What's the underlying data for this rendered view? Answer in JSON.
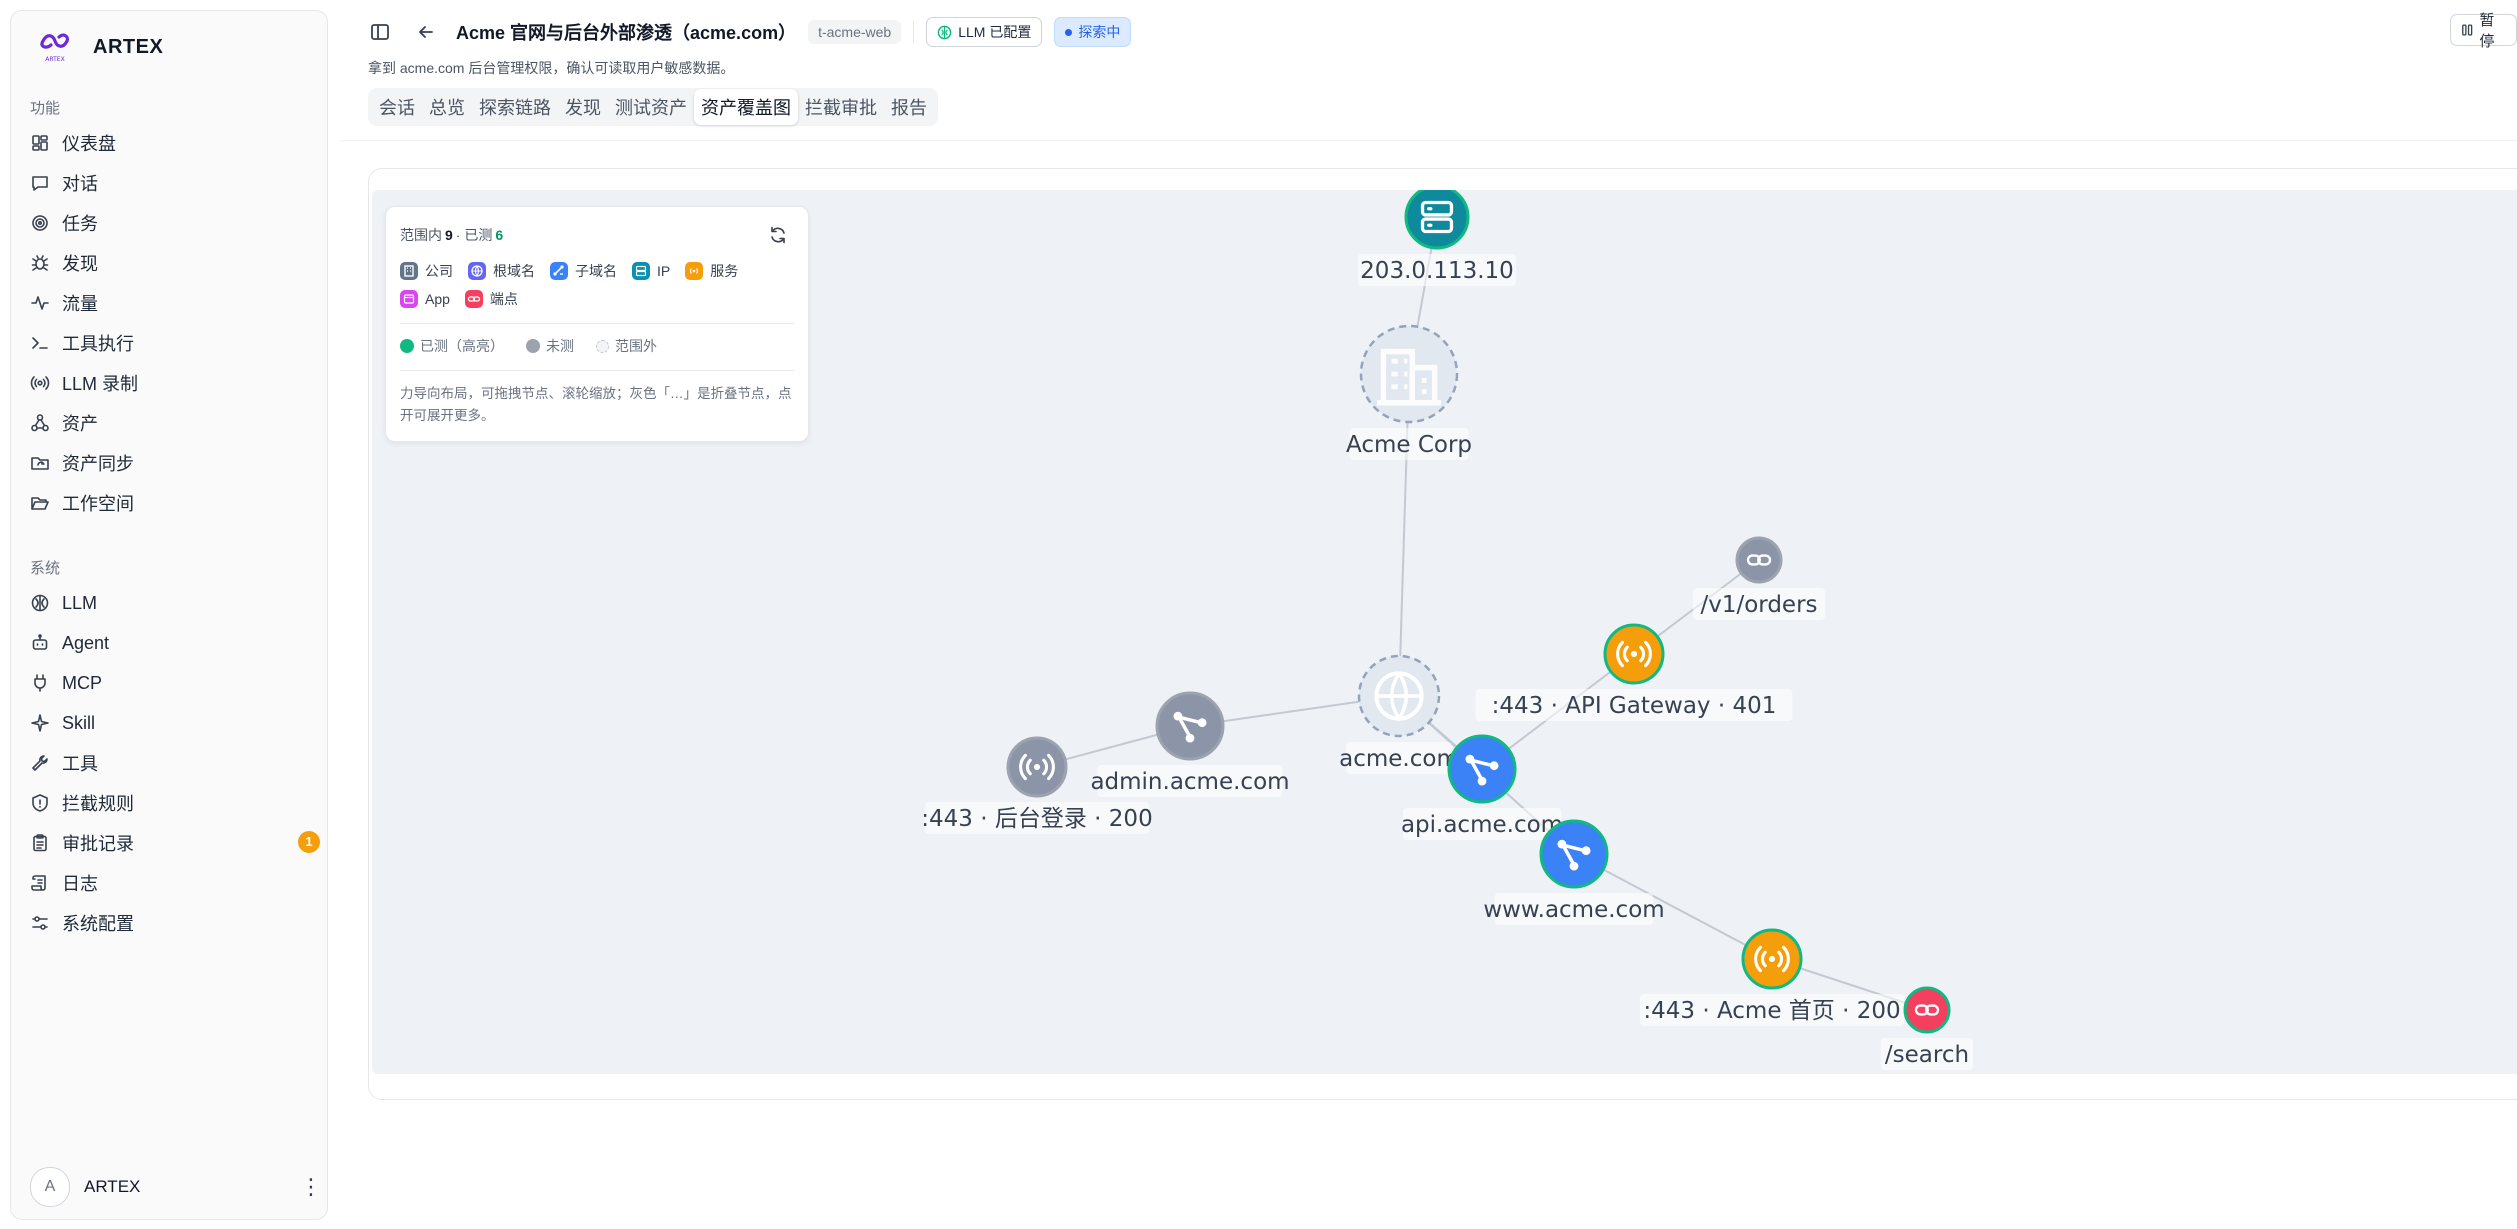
{
  "brand": {
    "name": "ARTEX",
    "logo_text": "ARTEX"
  },
  "sidebar": {
    "section_function": "功能",
    "section_system": "系统",
    "function_items": [
      {
        "label": "仪表盘",
        "icon": "dashboard-icon"
      },
      {
        "label": "对话",
        "icon": "chat-icon"
      },
      {
        "label": "任务",
        "icon": "target-icon"
      },
      {
        "label": "发现",
        "icon": "bug-icon"
      },
      {
        "label": "流量",
        "icon": "activity-icon"
      },
      {
        "label": "工具执行",
        "icon": "terminal-icon"
      },
      {
        "label": "LLM 录制",
        "icon": "radio-icon"
      },
      {
        "label": "资产",
        "icon": "network-icon"
      },
      {
        "label": "资产同步",
        "icon": "folder-sync-icon"
      },
      {
        "label": "工作空间",
        "icon": "folder-open-icon"
      }
    ],
    "system_items": [
      {
        "label": "LLM",
        "icon": "brain-icon"
      },
      {
        "label": "Agent",
        "icon": "bot-icon"
      },
      {
        "label": "MCP",
        "icon": "plug-icon"
      },
      {
        "label": "Skill",
        "icon": "sparkle-icon"
      },
      {
        "label": "工具",
        "icon": "wrench-icon"
      },
      {
        "label": "拦截规则",
        "icon": "shield-icon"
      },
      {
        "label": "审批记录",
        "icon": "clipboard-icon",
        "badge": "1"
      },
      {
        "label": "日志",
        "icon": "scroll-icon"
      },
      {
        "label": "系统配置",
        "icon": "sliders-icon"
      }
    ],
    "user": {
      "initial": "A",
      "name": "ARTEX"
    }
  },
  "header": {
    "title": "Acme 官网与后台外部渗透（acme.com）",
    "project_id": "t-acme-web",
    "llm_chip": "LLM 已配置",
    "status_chip": "探索中",
    "pause_label": "暂停",
    "subtitle": "拿到 acme.com 后台管理权限，确认可读取用户敏感数据。"
  },
  "tabs": [
    {
      "label": "会话",
      "active": false
    },
    {
      "label": "总览",
      "active": false
    },
    {
      "label": "探索链路",
      "active": false
    },
    {
      "label": "发现",
      "active": false
    },
    {
      "label": "测试资产",
      "active": false
    },
    {
      "label": "资产覆盖图",
      "active": true
    },
    {
      "label": "拦截审批",
      "active": false
    },
    {
      "label": "报告",
      "active": false
    }
  ],
  "legend": {
    "in_scope_label": "范围内",
    "in_scope_count": "9",
    "tested_label": "· 已测",
    "tested_count": "6",
    "types": [
      {
        "label": "公司",
        "color": "#64748b",
        "icon": "building-icon"
      },
      {
        "label": "根域名",
        "color": "#6366f1",
        "icon": "globe-icon"
      },
      {
        "label": "子域名",
        "color": "#3b82f6",
        "icon": "share-icon"
      },
      {
        "label": "IP",
        "color": "#0891b2",
        "icon": "server-icon"
      },
      {
        "label": "服务",
        "color": "#f59e0b",
        "icon": "radio-icon"
      },
      {
        "label": "App",
        "color": "#d946ef",
        "icon": "app-icon"
      },
      {
        "label": "端点",
        "color": "#f43f5e",
        "icon": "link-icon"
      }
    ],
    "status": [
      {
        "label": "已测（高亮）",
        "color": "#10b981"
      },
      {
        "label": "未测",
        "color": "#9ca3af"
      },
      {
        "label": "范围外",
        "color": "#e5e7eb"
      }
    ],
    "hint": "力导向布局，可拖拽节点、滚轮缩放；灰色「…」是折叠节点，点开可展开更多。"
  },
  "graph": {
    "nodes": [
      {
        "id": "ip",
        "label": "203.0.113.10",
        "kind": "ip",
        "tested": true
      },
      {
        "id": "company",
        "label": "Acme Corp",
        "kind": "company",
        "tested": false
      },
      {
        "id": "root",
        "label": "acme.com",
        "kind": "root",
        "tested": false
      },
      {
        "id": "admin",
        "label": "admin.acme.com",
        "kind": "subdomain",
        "tested": false
      },
      {
        "id": "admin443",
        "label": ":443 · 后台登录 · 200",
        "kind": "service",
        "tested": false
      },
      {
        "id": "api",
        "label": "api.acme.com",
        "kind": "subdomain",
        "tested": true
      },
      {
        "id": "api443",
        "label": ":443 · API Gateway · 401",
        "kind": "service",
        "tested": true
      },
      {
        "id": "orders",
        "label": "/v1/orders",
        "kind": "endpoint",
        "tested": false
      },
      {
        "id": "www",
        "label": "www.acme.com",
        "kind": "subdomain",
        "tested": true
      },
      {
        "id": "www443",
        "label": ":443 · Acme 首页 · 200",
        "kind": "service",
        "tested": true
      },
      {
        "id": "search",
        "label": "/search",
        "kind": "endpoint",
        "tested": true
      }
    ],
    "edges": [
      [
        "ip",
        "company"
      ],
      [
        "company",
        "root"
      ],
      [
        "root",
        "admin"
      ],
      [
        "admin",
        "admin443"
      ],
      [
        "root",
        "api"
      ],
      [
        "root",
        "www"
      ],
      [
        "api",
        "api443"
      ],
      [
        "api443",
        "orders"
      ],
      [
        "www",
        "www443"
      ],
      [
        "www443",
        "search"
      ]
    ]
  }
}
